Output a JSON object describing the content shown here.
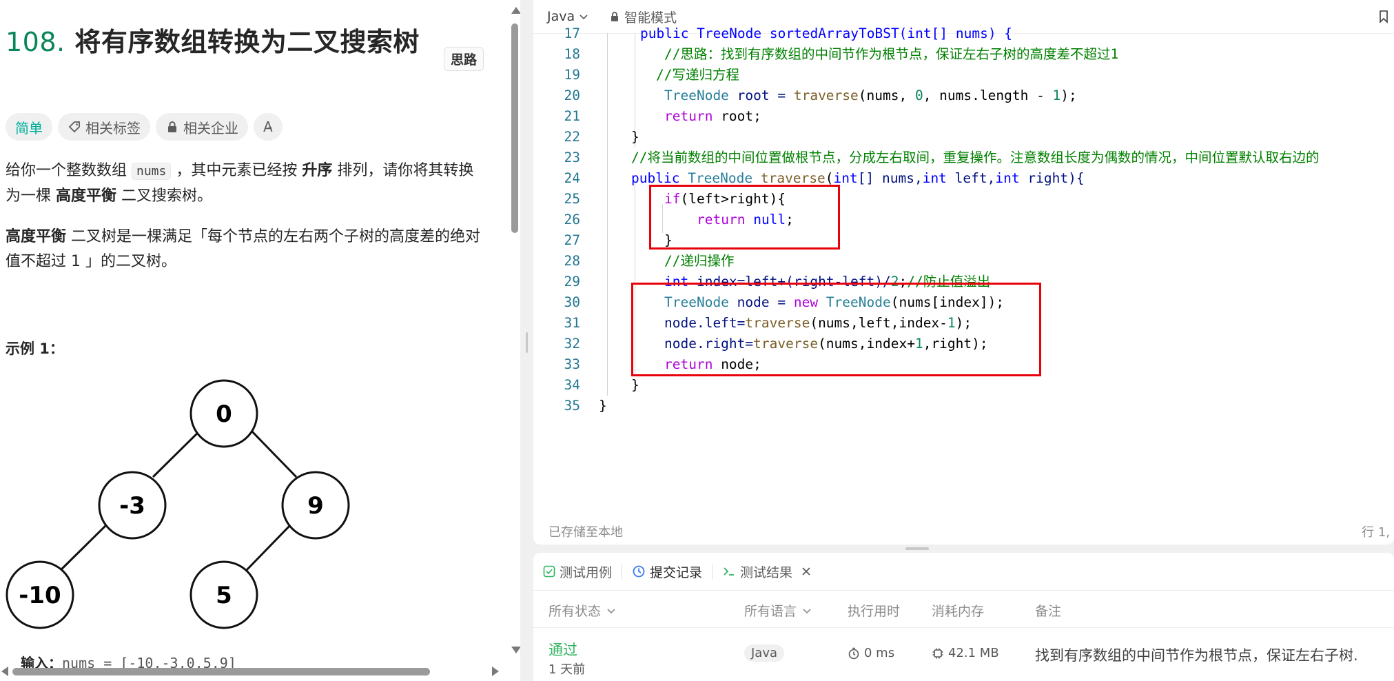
{
  "problem": {
    "number": "108.",
    "title": "将有序数组转换为二叉搜索树",
    "hint_badge": "思路",
    "tags": {
      "difficulty": "简单",
      "related_tags": "相关标签",
      "related_companies": "相关企业",
      "translate_icon_label": "A̵"
    },
    "description": {
      "p1_a": "给你一个整数数组 ",
      "p1_code": "nums",
      "p1_b": " ，其中元素已经按 ",
      "p1_bold1": "升序",
      "p1_c": " 排列，请你将其转换为一棵 ",
      "p1_bold2": "高度平衡",
      "p1_d": " 二叉搜索树。",
      "p2_bold": "高度平衡",
      "p2_text": " 二叉树是一棵满足「每个节点的左右两个子树的高度差的绝对值不超过 1 」的二叉树。"
    },
    "example_title": "示例 1：",
    "tree_nodes": [
      "0",
      "-3",
      "9",
      "-10",
      "5"
    ],
    "input_label": "输入：",
    "input_value": "nums = [-10,-3,0,5,9]"
  },
  "editor": {
    "language": "Java",
    "mode": "智能模式",
    "saved_status": "已存储至本地",
    "cursor_pos": "行 1,",
    "line_numbers": [
      "17",
      "18",
      "19",
      "20",
      "21",
      "22",
      "23",
      "24",
      "25",
      "26",
      "27",
      "28",
      "29",
      "30",
      "31",
      "32",
      "33",
      "34",
      "35"
    ],
    "lines": {
      "l17": "public TreeNode sortedArrayToBST(int[] nums) {",
      "l18": "//思路：找到有序数组的中间节作为根节点，保证左右子树的高度差不超过1",
      "l19": "//写递归方程",
      "l20a": "TreeNode",
      "l20b": " root = ",
      "l20c": "traverse",
      "l20d": "(nums, ",
      "l20e": "0",
      "l20f": ", nums.length - ",
      "l20g": "1",
      "l20h": ");",
      "l21a": "return",
      "l21b": " root;",
      "l22": "}",
      "l23": "//将当前数组的中间位置做根节点，分成左右取间，重复操作。注意数组长度为偶数的情况，中间位置默认取右边的",
      "l24a": "public",
      "l24b": " ",
      "l24c": "TreeNode",
      "l24d": " ",
      "l24e": "traverse",
      "l24f": "(",
      "l24g": "int",
      "l24h": "[] nums,",
      "l24i": "int",
      "l24j": " left,",
      "l24k": "int",
      "l24l": " right){",
      "l25a": "if",
      "l25b": "(left>right){",
      "l26a": "return",
      "l26b": " ",
      "l26c": "null",
      "l26d": ";",
      "l27": "}",
      "l28": "//递归操作",
      "l29a": "int",
      "l29b": " index=left+(right-left)/",
      "l29c": "2",
      "l29d": ";",
      "l29e": "//防止值溢出",
      "l30a": "TreeNode",
      "l30b": " node = ",
      "l30c": "new",
      "l30d": " ",
      "l30e": "TreeNode",
      "l30f": "(nums[index]);",
      "l31a": "node.left=",
      "l31b": "traverse",
      "l31c": "(nums,left,index-",
      "l31d": "1",
      "l31e": ");",
      "l32a": "node.right=",
      "l32b": "traverse",
      "l32c": "(nums,index+",
      "l32d": "1",
      "l32e": ",right);",
      "l33a": "return",
      "l33b": " node;",
      "l34": "}",
      "l35": "}"
    }
  },
  "results": {
    "tabs": [
      "测试用例",
      "提交记录",
      "测试结果"
    ],
    "headers": {
      "status": "所有状态",
      "language": "所有语言",
      "runtime": "执行用时",
      "memory": "消耗内存",
      "notes": "备注"
    },
    "rows": [
      {
        "status": "通过",
        "when": "1 天前",
        "language": "Java",
        "runtime": "0 ms",
        "memory": "42.1 MB",
        "note": "找到有序数组的中间节作为根节点，保证左右子树."
      }
    ]
  },
  "colors": {
    "accent_green": "#2db55d",
    "difficulty_teal": "#00af9b",
    "highlight_red": "#e8000b"
  }
}
